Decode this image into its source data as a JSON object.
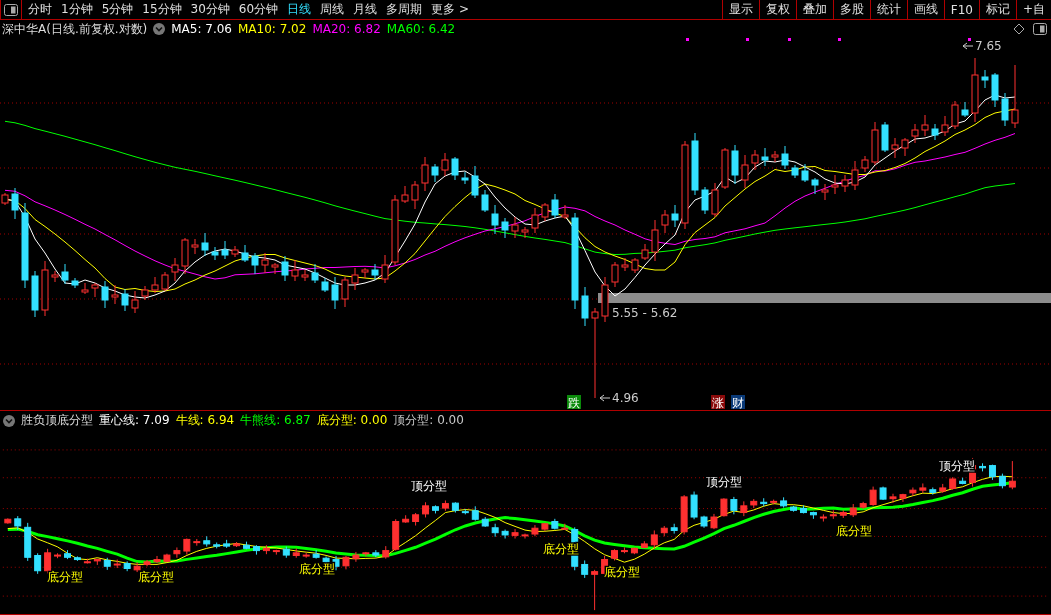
{
  "toolbar": {
    "periods": [
      {
        "label": "分时",
        "selected": false
      },
      {
        "label": "1分钟",
        "selected": false
      },
      {
        "label": "5分钟",
        "selected": false
      },
      {
        "label": "15分钟",
        "selected": false
      },
      {
        "label": "30分钟",
        "selected": false
      },
      {
        "label": "60分钟",
        "selected": false
      },
      {
        "label": "日线",
        "selected": true
      },
      {
        "label": "周线",
        "selected": false
      },
      {
        "label": "月线",
        "selected": false
      },
      {
        "label": "多周期",
        "selected": false
      },
      {
        "label": "更多 >",
        "selected": false
      }
    ],
    "tools": [
      "显示",
      "复权",
      "叠加",
      "多股",
      "统计",
      "画线",
      "F10",
      "标记",
      "+自"
    ]
  },
  "chart": {
    "title": "深中华A(日线.前复权.对数)",
    "indicators": [
      {
        "label": "MA5: 7.06",
        "color": "#ffffff"
      },
      {
        "label": "MA10: 7.02",
        "color": "#ffff00"
      },
      {
        "label": "MA20: 6.82",
        "color": "#ff00ff"
      },
      {
        "label": "MA60: 6.42",
        "color": "#00ff00"
      }
    ],
    "annotations": [
      {
        "kind": "high",
        "text": "7.65"
      },
      {
        "kind": "range",
        "text": "5.55 - 5.62"
      },
      {
        "kind": "low",
        "text": "4.96"
      }
    ],
    "badges": [
      {
        "text": "跌",
        "color": "#0a8a0a"
      },
      {
        "text": "涨",
        "color": "#8a0a0a"
      },
      {
        "text": "财",
        "color": "#0a3a78"
      }
    ]
  },
  "lower_panel": {
    "title": "胜负顶底分型",
    "indicators": [
      {
        "label": "重心线: 7.09",
        "color": "#ffffff"
      },
      {
        "label": "牛线: 6.94",
        "color": "#ffff00"
      },
      {
        "label": "牛熊线: 6.87",
        "color": "#00ff00"
      },
      {
        "label": "底分型: 0.00",
        "color": "#ffff00"
      },
      {
        "label": "顶分型: 0.00",
        "color": "#c8c8c8"
      }
    ],
    "signals": [
      {
        "kind": "bottom",
        "label": "底分型"
      },
      {
        "kind": "bottom",
        "label": "底分型"
      },
      {
        "kind": "bottom",
        "label": "底分型"
      },
      {
        "kind": "top",
        "label": "顶分型"
      },
      {
        "kind": "bottom",
        "label": "底分型"
      },
      {
        "kind": "bottom",
        "label": "底分型"
      },
      {
        "kind": "top",
        "label": "顶分型"
      },
      {
        "kind": "bottom",
        "label": "底分型"
      },
      {
        "kind": "top",
        "label": "顶分型"
      }
    ]
  }
}
